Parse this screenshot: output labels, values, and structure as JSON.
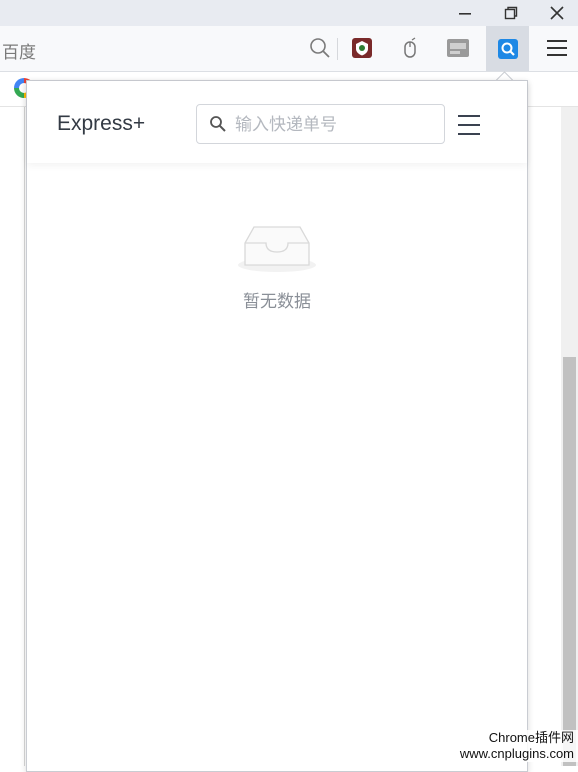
{
  "browser": {
    "omnibox_text": "百度",
    "window_buttons": [
      "minimize-icon",
      "restore-icon",
      "close-icon"
    ],
    "toolbar_icons": [
      "search-icon",
      "shield-extension-icon",
      "mouse-extension-icon",
      "ocr-extension-icon",
      "express-extension-icon",
      "menu-icon"
    ]
  },
  "popup": {
    "app_name": "Express+",
    "search": {
      "placeholder": "输入快递单号",
      "value": ""
    },
    "empty_state": {
      "icon": "empty-inbox-icon",
      "text": "暂无数据"
    }
  },
  "watermark": {
    "line1": "Chrome插件网",
    "line2": "www.cnplugins.com"
  },
  "colors": {
    "active_extension_bg": "#d8dce3",
    "extension_blue": "#1e88e5",
    "menu_icon": "#3a4250",
    "empty_text": "#8a8f97"
  }
}
